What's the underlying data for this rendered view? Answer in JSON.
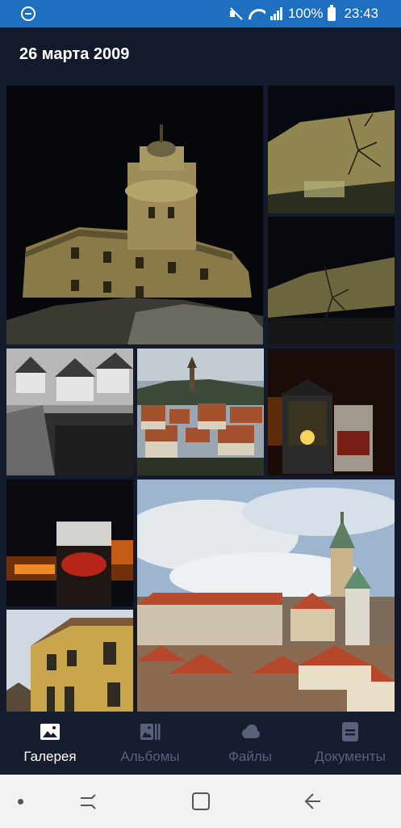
{
  "status_bar": {
    "battery": "100%",
    "time": "23:43",
    "icons": [
      "do-not-disturb-icon",
      "mute-icon",
      "wifi-icon",
      "signal-icon",
      "battery-icon"
    ]
  },
  "header": {
    "date": "26 марта 2009"
  },
  "gallery": {
    "photos": [
      {
        "name": "castle-tower-night"
      },
      {
        "name": "castle-wall-night"
      },
      {
        "name": "castle-river-night"
      },
      {
        "name": "old-town-bw"
      },
      {
        "name": "town-panorama"
      },
      {
        "name": "lantern-beer"
      },
      {
        "name": "beer-glass"
      },
      {
        "name": "castle-tower-day"
      },
      {
        "name": "yellow-house"
      }
    ]
  },
  "bottom_nav": {
    "items": [
      {
        "label": "Галерея",
        "icon": "image-icon",
        "active": true
      },
      {
        "label": "Альбомы",
        "icon": "albums-icon",
        "active": false
      },
      {
        "label": "Файлы",
        "icon": "cloud-icon",
        "active": false
      },
      {
        "label": "Документы",
        "icon": "document-icon",
        "active": false
      }
    ]
  },
  "system_nav": {
    "buttons": [
      "dot-indicator",
      "recent-apps-icon",
      "home-icon",
      "back-icon"
    ]
  },
  "colors": {
    "status_bar": "#1f6fc1",
    "background": "#131a2b",
    "nav_active": "#ffffff",
    "nav_inactive": "#59607a"
  }
}
